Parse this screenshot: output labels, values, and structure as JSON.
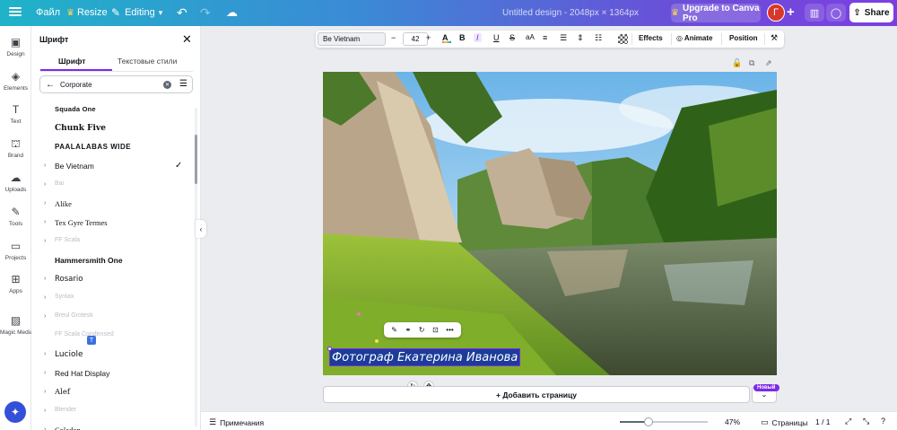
{
  "topbar": {
    "file": "Файл",
    "resize": "Resize",
    "editing": "Editing",
    "design_title": "Untitled design - 2048px × 1364px",
    "upgrade": "Upgrade to Canva Pro",
    "avatar_initial": "Г",
    "share": "Share"
  },
  "rail": {
    "items": [
      {
        "label": "Design",
        "icon": "layout-icon"
      },
      {
        "label": "Elements",
        "icon": "shapes-icon"
      },
      {
        "label": "Text",
        "icon": "text-icon"
      },
      {
        "label": "Brand",
        "icon": "brand-icon"
      },
      {
        "label": "Uploads",
        "icon": "upload-icon"
      },
      {
        "label": "Tools",
        "icon": "pen-icon"
      },
      {
        "label": "Projects",
        "icon": "folder-icon"
      },
      {
        "label": "Apps",
        "icon": "apps-icon"
      },
      {
        "label": "Magic Media",
        "icon": "magic-media-icon"
      }
    ]
  },
  "panel": {
    "title": "Шрифт",
    "tabs": [
      "Шрифт",
      "Текстовые стили"
    ],
    "search_value": "Corporate",
    "fonts": [
      {
        "name": "Squada One",
        "expand": false,
        "faded": false,
        "selected": false
      },
      {
        "name": "Chunk Five",
        "expand": false,
        "faded": false,
        "selected": false
      },
      {
        "name": "PAALALABAS WIDE",
        "expand": false,
        "faded": false,
        "selected": false
      },
      {
        "name": "Be Vietnam",
        "expand": true,
        "faded": false,
        "selected": true
      },
      {
        "name": "Bai",
        "expand": true,
        "faded": true,
        "selected": false
      },
      {
        "name": "Alike",
        "expand": true,
        "faded": false,
        "selected": false
      },
      {
        "name": "Tex Gyre Termes",
        "expand": true,
        "faded": false,
        "selected": false
      },
      {
        "name": "FF Scala",
        "expand": true,
        "faded": true,
        "selected": false
      },
      {
        "name": "Hammersmith One",
        "expand": false,
        "faded": false,
        "selected": false
      },
      {
        "name": "Rosario",
        "expand": true,
        "faded": false,
        "selected": false
      },
      {
        "name": "Syntax",
        "expand": true,
        "faded": true,
        "selected": false
      },
      {
        "name": "Breul Grotesk",
        "expand": true,
        "faded": true,
        "selected": false
      },
      {
        "name": "FF Scala Condensed",
        "expand": false,
        "faded": true,
        "selected": false
      },
      {
        "name": "Luciole",
        "expand": true,
        "faded": false,
        "selected": false
      },
      {
        "name": "Red Hat Display",
        "expand": true,
        "faded": false,
        "selected": false
      },
      {
        "name": "Alef",
        "expand": true,
        "faded": false,
        "selected": false
      },
      {
        "name": "Blender",
        "expand": true,
        "faded": true,
        "selected": false
      },
      {
        "name": "Coladon",
        "expand": true,
        "faded": false,
        "selected": false
      }
    ]
  },
  "toolbar": {
    "font_name": "Be Vietnam",
    "font_size": "42",
    "effects": "Effects",
    "animate": "Animate",
    "position": "Position"
  },
  "canvas": {
    "caption": "Фотограф Екатерина Иванова"
  },
  "add_page": {
    "label": "+ Добавить страницу",
    "new_badge": "Новый"
  },
  "bottombar": {
    "notes": "Примечания",
    "zoom": "47%",
    "zoom_level": 0.47,
    "pages": "Страницы",
    "page_num": "1 / 1"
  },
  "colors": {
    "accent": "#7d2ae8",
    "avatar": "#d8372a",
    "selection": "#1c3c99"
  }
}
